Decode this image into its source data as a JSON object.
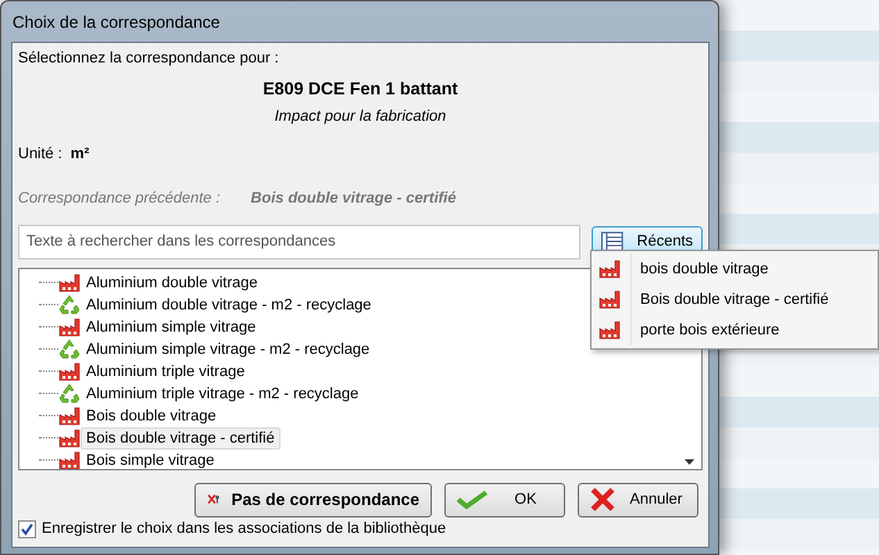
{
  "window": {
    "title": "Choix de la correspondance"
  },
  "header": {
    "prompt": "Sélectionnez la correspondance pour :",
    "item_name": "E809 DCE Fen 1 battant",
    "subtitle": "Impact pour la fabrication",
    "unit_label": "Unité :",
    "unit_value": "m²",
    "previous_label": "Correspondance précédente :",
    "previous_value": "Bois double vitrage - certifié"
  },
  "search": {
    "placeholder": "Texte à rechercher dans les correspondances"
  },
  "recent_button": {
    "label": "Récents",
    "open": true
  },
  "recent_menu": [
    {
      "label": "bois double vitrage",
      "kind": "factory"
    },
    {
      "label": "Bois double vitrage - certifié",
      "kind": "factory"
    },
    {
      "label": "porte bois extérieure",
      "kind": "factory"
    }
  ],
  "tree": [
    {
      "label": "Aluminium double vitrage",
      "kind": "factory",
      "selected": false
    },
    {
      "label": "Aluminium double vitrage - m2 - recyclage",
      "kind": "recycle",
      "selected": false
    },
    {
      "label": "Aluminium simple vitrage",
      "kind": "factory",
      "selected": false
    },
    {
      "label": "Aluminium simple vitrage - m2 - recyclage",
      "kind": "recycle",
      "selected": false
    },
    {
      "label": "Aluminium triple vitrage",
      "kind": "factory",
      "selected": false
    },
    {
      "label": "Aluminium triple vitrage - m2 - recyclage",
      "kind": "recycle",
      "selected": false
    },
    {
      "label": "Bois double vitrage",
      "kind": "factory",
      "selected": false
    },
    {
      "label": "Bois double vitrage - certifié",
      "kind": "factory",
      "selected": true
    },
    {
      "label": "Bois simple vitrage",
      "kind": "factory",
      "selected": false
    }
  ],
  "buttons": [
    {
      "label": "Pas de correspondance",
      "kind": "none"
    },
    {
      "label": "OK",
      "kind": "ok"
    },
    {
      "label": "Annuler",
      "kind": "cancel"
    }
  ],
  "save_option": {
    "label": "Enregistrer le choix dans les associations de la bibliothèque",
    "checked": true
  }
}
